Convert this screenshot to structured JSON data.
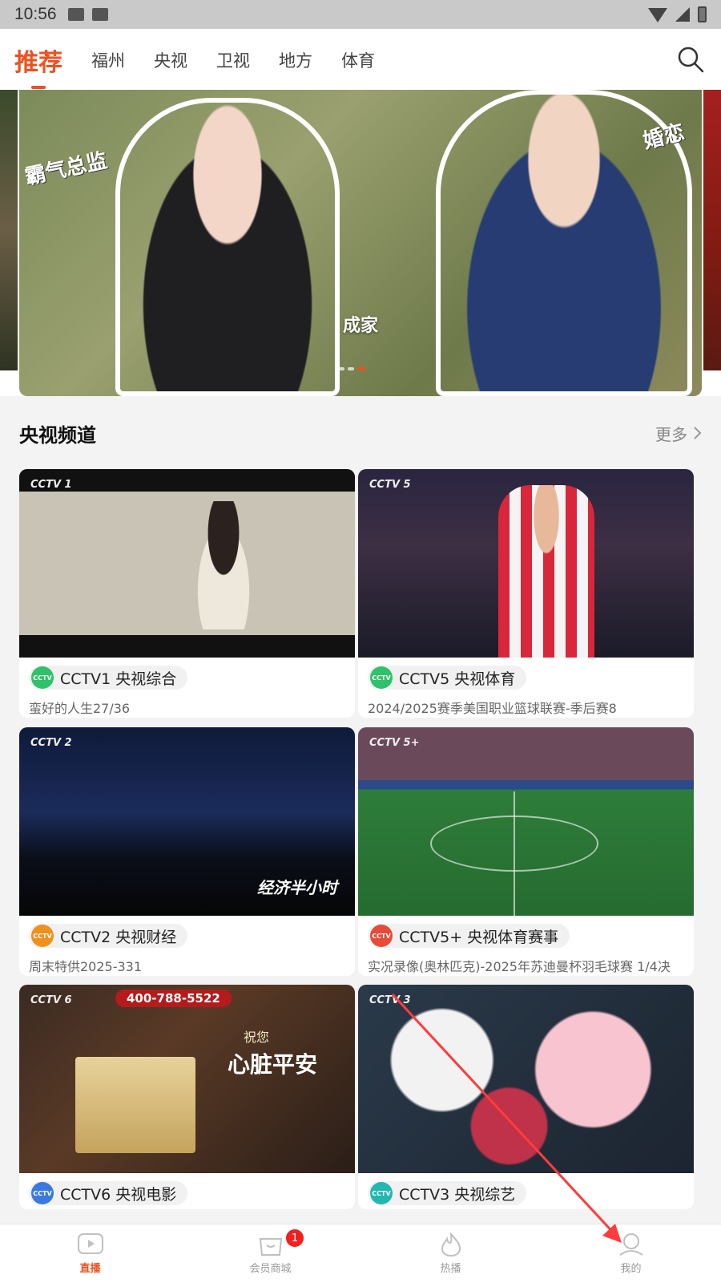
{
  "status_bar": {
    "time": "10:56"
  },
  "top_nav": {
    "tabs": [
      {
        "label": "推荐",
        "active": true
      },
      {
        "label": "福州",
        "active": false
      },
      {
        "label": "央视",
        "active": false
      },
      {
        "label": "卫视",
        "active": false
      },
      {
        "label": "地方",
        "active": false
      },
      {
        "label": "体育",
        "active": false
      }
    ],
    "search_icon": "search-icon"
  },
  "banner": {
    "title": "成家",
    "deco_left": "霸气总监",
    "deco_right": "婚恋",
    "dot_count": 3,
    "active_dot": 3
  },
  "section": {
    "title": "央视频道",
    "more_label": "更多"
  },
  "channels": [
    {
      "name": "CCTV1 央视综合",
      "program": "蛮好的人生27/36",
      "chip_color": "#2fc26a",
      "thumb_logo": "CCTV 1"
    },
    {
      "name": "CCTV5 央视体育",
      "program": "2024/2025赛季美国职业篮球联赛-季后赛8",
      "chip_color": "#2fc26a",
      "thumb_logo": "CCTV 5"
    },
    {
      "name": "CCTV2 央视财经",
      "program": "周末特供2025-331",
      "chip_color": "#f0901e",
      "thumb_logo": "CCTV 2"
    },
    {
      "name": "CCTV5+ 央视体育赛事",
      "program": "实况录像(奥林匹克)-2025年苏迪曼杯羽毛球赛 1/4决",
      "chip_color": "#e84a3a",
      "thumb_logo": "CCTV 5+"
    },
    {
      "name": "CCTV6 央视电影",
      "program": "",
      "chip_color": "#3a7ae0",
      "thumb_logo": "CCTV 6"
    },
    {
      "name": "CCTV3 央视综艺",
      "program": "",
      "chip_color": "#22b8b0",
      "thumb_logo": "CCTV 3"
    }
  ],
  "thumb_text": {
    "cctv2_overlay": "经济半小时",
    "cctv6_hotline": "400-788-5522",
    "cctv6_slogan": "心脏平安",
    "cctv6_pre": "祝您"
  },
  "tabbar": {
    "items": [
      {
        "label": "直播",
        "active": true,
        "icon": "play-icon"
      },
      {
        "label": "会员商城",
        "active": false,
        "icon": "shopping-bag-icon",
        "badge": "1"
      },
      {
        "label": "热播",
        "active": false,
        "icon": "flame-icon"
      },
      {
        "label": "我的",
        "active": false,
        "icon": "user-icon"
      }
    ]
  },
  "colors": {
    "accent": "#f0501e",
    "badge": "#f02020",
    "arrow": "#ff3b3b"
  }
}
